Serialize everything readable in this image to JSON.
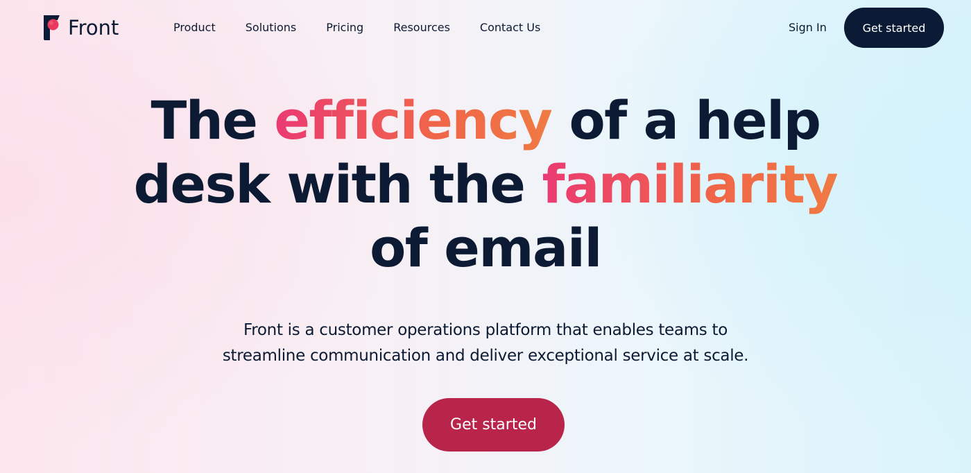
{
  "brand": {
    "name": "Front",
    "icon": "front-logo-icon",
    "colors": {
      "navy": "#0b1a35",
      "accent_pink": "#ea3a73",
      "accent_orange": "#f07a43",
      "cta_red": "#b8244a"
    }
  },
  "nav": {
    "links": [
      {
        "label": "Product"
      },
      {
        "label": "Solutions"
      },
      {
        "label": "Pricing"
      },
      {
        "label": "Resources"
      },
      {
        "label": "Contact Us"
      }
    ],
    "sign_in_label": "Sign In",
    "get_started_label": "Get started"
  },
  "hero": {
    "title": {
      "line1": {
        "pre": "The ",
        "highlight": "efficiency",
        "post": " of a help"
      },
      "line2": {
        "pre": "desk with the ",
        "highlight": "familiarity",
        "post": ""
      },
      "line3": {
        "pre": "of email"
      }
    },
    "subtitle": {
      "line1": "Front is a customer operations platform that enables teams to",
      "line2": "streamline communication and deliver exceptional service at scale."
    },
    "cta_label": "Get started"
  }
}
